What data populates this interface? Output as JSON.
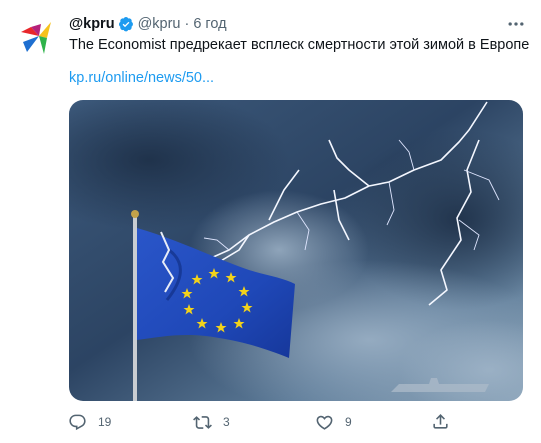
{
  "tweet": {
    "display_name": "@kpru",
    "handle": "@kpru",
    "separator": "·",
    "timestamp": "6 год",
    "text": "The Economist предрекает всплеск смертности этой зимой в Европе",
    "link": "kp.ru/online/news/50...",
    "verified": true,
    "media": {
      "subject": "EU flag under lightning"
    }
  },
  "actions": {
    "reply_count": "19",
    "retweet_count": "3",
    "like_count": "9"
  },
  "colors": {
    "link": "#1d9bf0",
    "muted": "#536471",
    "verified": "#1d9bf0",
    "flag_blue": "#1f48b8",
    "flag_stars": "#f2d21b"
  },
  "icons": [
    "kp-logo-icon",
    "verified-badge-icon",
    "more-icon",
    "reply-icon",
    "retweet-icon",
    "like-icon",
    "share-icon"
  ]
}
